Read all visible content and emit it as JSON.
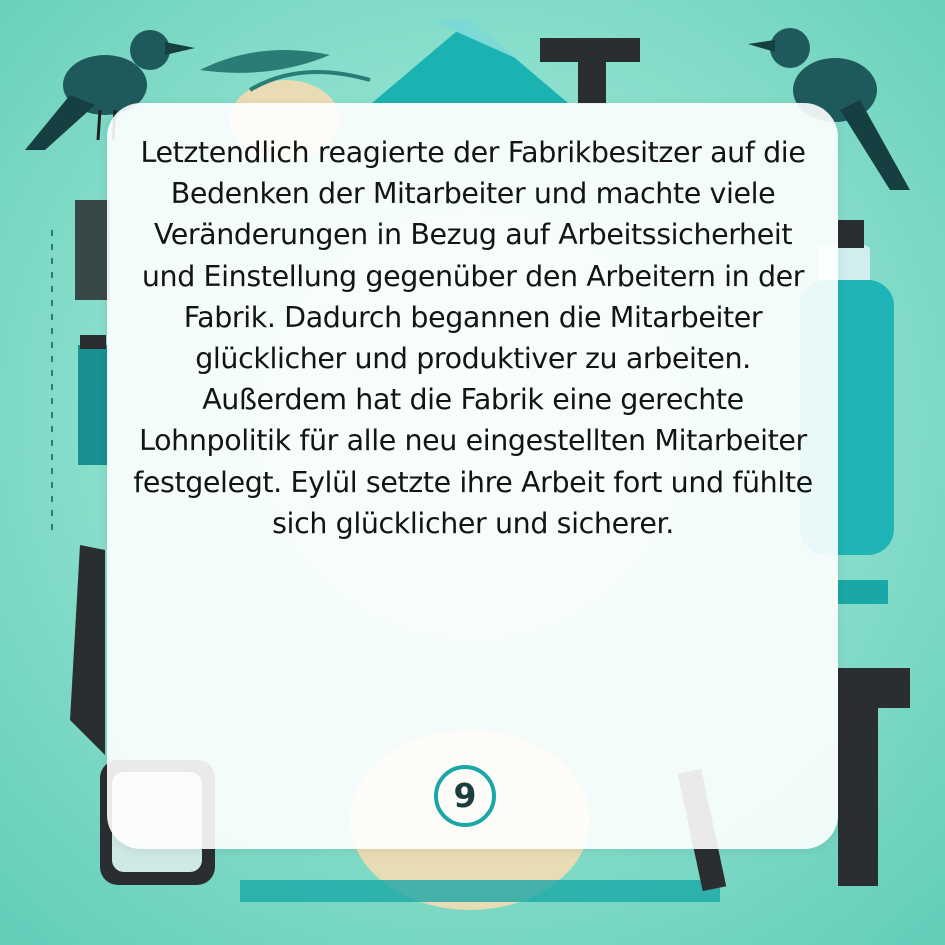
{
  "story": {
    "text": "Letztendlich reagierte der Fabrikbesitzer auf die Bedenken der Mitarbeiter und machte viele Veränderungen in Bezug auf Arbeitssicherheit und Einstellung gegenüber den Arbeitern in der Fabrik. Dadurch begannen die Mitarbeiter glücklicher und produktiver zu arbeiten. Außerdem hat die Fabrik eine gerechte Lohnpolitik für alle neu eingestellten Mitarbeiter festgelegt. Eylül setzte ihre Arbeit fort und fühlte sich glücklicher und sicherer.",
    "page_number": "9"
  },
  "colors": {
    "background": "#8fe1cf",
    "teal_accent": "#1aa7a8",
    "dark": "#1f2326",
    "bird": "#1e5a5c",
    "card": "#ffffff",
    "text": "#141414"
  },
  "icons": [
    "crow-icon",
    "crow-icon",
    "bottle-icon",
    "tshape-icon",
    "gear-icon",
    "tools-icon"
  ]
}
